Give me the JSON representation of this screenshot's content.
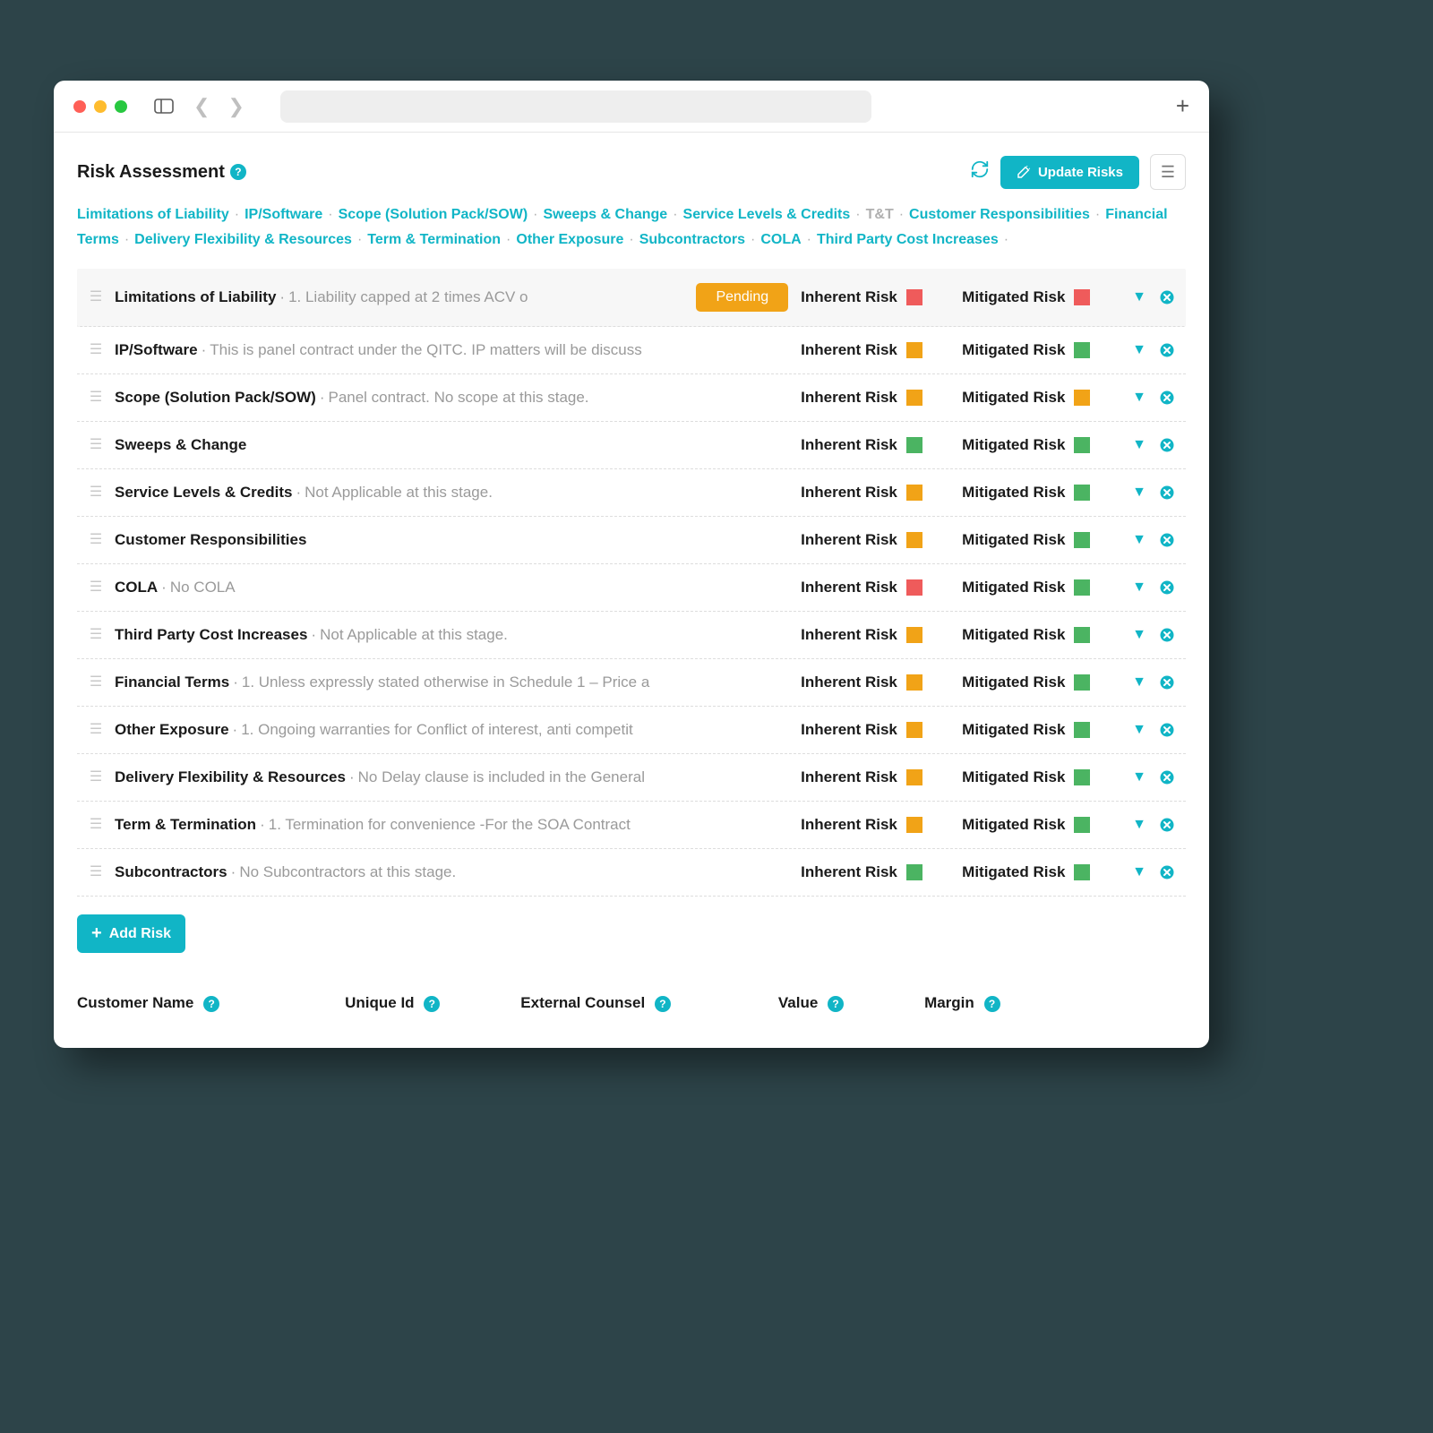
{
  "page": {
    "title": "Risk Assessment",
    "update_button": "Update Risks",
    "add_risk_button": "Add Risk"
  },
  "tags": [
    {
      "label": "Limitations of Liability",
      "muted": false
    },
    {
      "label": "IP/Software",
      "muted": false
    },
    {
      "label": "Scope (Solution Pack/SOW)",
      "muted": false
    },
    {
      "label": "Sweeps & Change",
      "muted": false
    },
    {
      "label": "Service Levels & Credits",
      "muted": false
    },
    {
      "label": "T&T",
      "muted": true
    },
    {
      "label": "Customer Responsibilities",
      "muted": false
    },
    {
      "label": "Financial Terms",
      "muted": false
    },
    {
      "label": "Delivery Flexibility & Resources",
      "muted": false
    },
    {
      "label": "Term & Termination",
      "muted": false
    },
    {
      "label": "Other Exposure",
      "muted": false
    },
    {
      "label": "Subcontractors",
      "muted": false
    },
    {
      "label": "COLA",
      "muted": false
    },
    {
      "label": "Third Party Cost Increases",
      "muted": false
    }
  ],
  "labels": {
    "inherent": "Inherent Risk",
    "mitigated": "Mitigated Risk",
    "pending": "Pending"
  },
  "risks": [
    {
      "name": "Limitations of Liability",
      "desc": "1. Liability capped at 2 times ACV o",
      "pending": true,
      "inherent": "red",
      "mitigated": "red",
      "highlight": true
    },
    {
      "name": "IP/Software",
      "desc": "This is panel contract under the QITC. IP matters will be discuss",
      "pending": false,
      "inherent": "orange",
      "mitigated": "green"
    },
    {
      "name": "Scope (Solution Pack/SOW)",
      "desc": "Panel contract. No scope at this stage.",
      "pending": false,
      "inherent": "orange",
      "mitigated": "orange"
    },
    {
      "name": "Sweeps & Change",
      "desc": "",
      "pending": false,
      "inherent": "green",
      "mitigated": "green"
    },
    {
      "name": "Service Levels & Credits",
      "desc": "Not Applicable at this stage.",
      "pending": false,
      "inherent": "orange",
      "mitigated": "green"
    },
    {
      "name": "Customer Responsibilities",
      "desc": "",
      "pending": false,
      "inherent": "orange",
      "mitigated": "green"
    },
    {
      "name": "COLA",
      "desc": "No COLA",
      "pending": false,
      "inherent": "red",
      "mitigated": "green"
    },
    {
      "name": "Third Party Cost Increases",
      "desc": "Not Applicable at this stage.",
      "pending": false,
      "inherent": "orange",
      "mitigated": "green"
    },
    {
      "name": "Financial Terms",
      "desc": "1. Unless expressly stated otherwise in Schedule 1 – Price a",
      "pending": false,
      "inherent": "orange",
      "mitigated": "green"
    },
    {
      "name": "Other Exposure",
      "desc": "1. Ongoing warranties for Conflict of interest, anti competit",
      "pending": false,
      "inherent": "orange",
      "mitigated": "green"
    },
    {
      "name": "Delivery Flexibility & Resources",
      "desc": "No Delay clause is included in the General",
      "pending": false,
      "inherent": "orange",
      "mitigated": "green"
    },
    {
      "name": "Term & Termination",
      "desc": "1. Termination for convenience -For the SOA Contract",
      "pending": false,
      "inherent": "orange",
      "mitigated": "green"
    },
    {
      "name": "Subcontractors",
      "desc": "No Subcontractors at this stage.",
      "pending": false,
      "inherent": "green",
      "mitigated": "green"
    }
  ],
  "fields": {
    "customer_name": "Customer Name",
    "unique_id": "Unique Id",
    "external_counsel": "External Counsel",
    "value": "Value",
    "margin": "Margin"
  }
}
